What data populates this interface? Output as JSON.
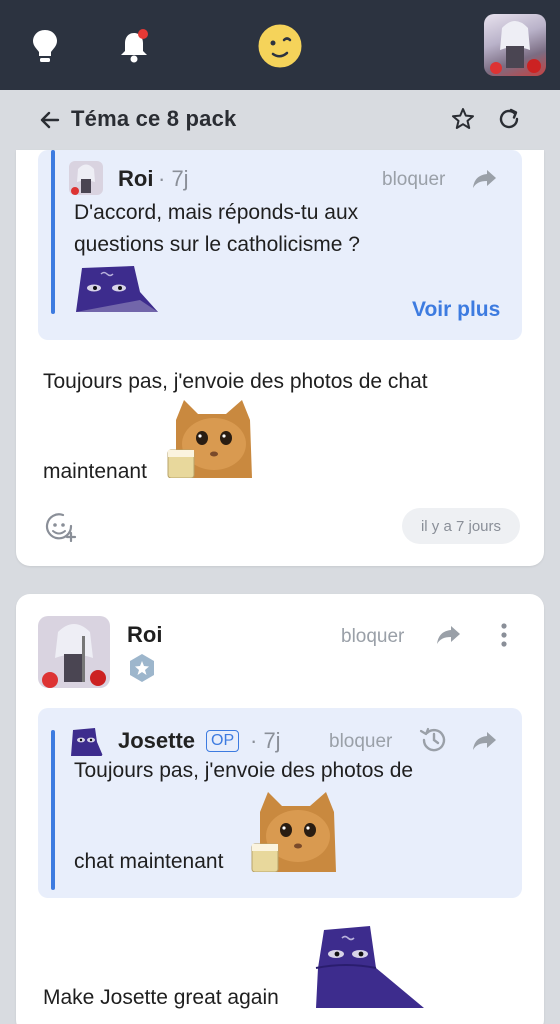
{
  "header": {
    "thread_title": "Téma ce 8 pack"
  },
  "colors": {
    "topbar": "#2c3340",
    "accent": "#3d7be0",
    "quote_bg": "#e8eefb"
  },
  "card1": {
    "quote": {
      "author": "Roi",
      "age": "· 7j",
      "block_label": "bloquer",
      "text_line1": "D'accord, mais réponds-tu aux",
      "text_line2": "questions sur le catholicisme ?",
      "more_label": "Voir plus"
    },
    "body_line1": "Toujours pas, j'envoie des photos de chat",
    "body_line2": "maintenant",
    "timestamp": "il y a 7 jours"
  },
  "card2": {
    "author": "Roi",
    "block_label": "bloquer",
    "quote": {
      "author": "Josette",
      "op_label": "OP",
      "age": "· 7j",
      "block_label": "bloquer",
      "text_line1": "Toujours pas, j'envoie des photos de",
      "text_line2": "chat maintenant"
    },
    "body": "Make Josette great again"
  },
  "icons": [
    "bulb-icon",
    "bell-icon",
    "smiley-icon",
    "back-arrow-icon",
    "star-icon",
    "refresh-icon",
    "share-icon",
    "add-reaction-icon",
    "more-vertical-icon",
    "history-icon"
  ]
}
